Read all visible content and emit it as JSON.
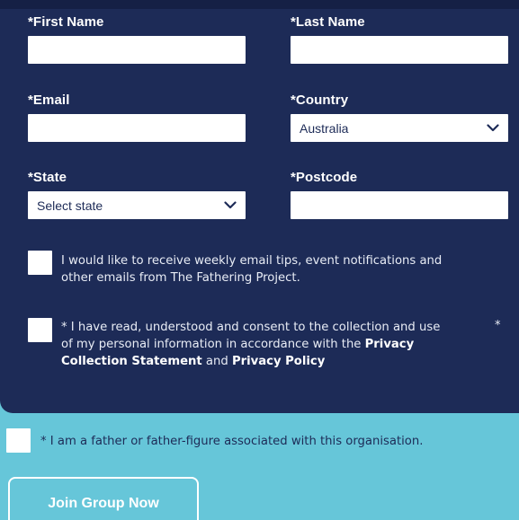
{
  "form": {
    "first_name": {
      "label": "*First Name",
      "value": ""
    },
    "last_name": {
      "label": "*Last Name",
      "value": ""
    },
    "email": {
      "label": "*Email",
      "value": ""
    },
    "country": {
      "label": "*Country",
      "selected": "Australia"
    },
    "state": {
      "label": "*State",
      "selected": "Select state"
    },
    "postcode": {
      "label": "*Postcode",
      "value": ""
    }
  },
  "checkboxes": {
    "newsletter": {
      "line1": "I would like to receive weekly email tips, event notifications and",
      "line2": "other emails from The Fathering Project.",
      "checked": false
    },
    "consent": {
      "line1": "* I have read, understood and consent to the collection and use",
      "trailing_star": "*",
      "line2_prefix": "of my personal information in accordance with the ",
      "link_privacy_collection_1": "Privacy",
      "link_privacy_collection_2": "Collection Statement",
      "and_text": " and ",
      "link_privacy_policy": "Privacy Policy",
      "checked": false
    },
    "father": {
      "text": "* I am a father or father-figure associated with this organisation.",
      "checked": false
    }
  },
  "actions": {
    "join_label": "Join Group Now"
  },
  "colors": {
    "navy": "#1d2b57",
    "teal": "#66c6d9",
    "white": "#ffffff"
  }
}
